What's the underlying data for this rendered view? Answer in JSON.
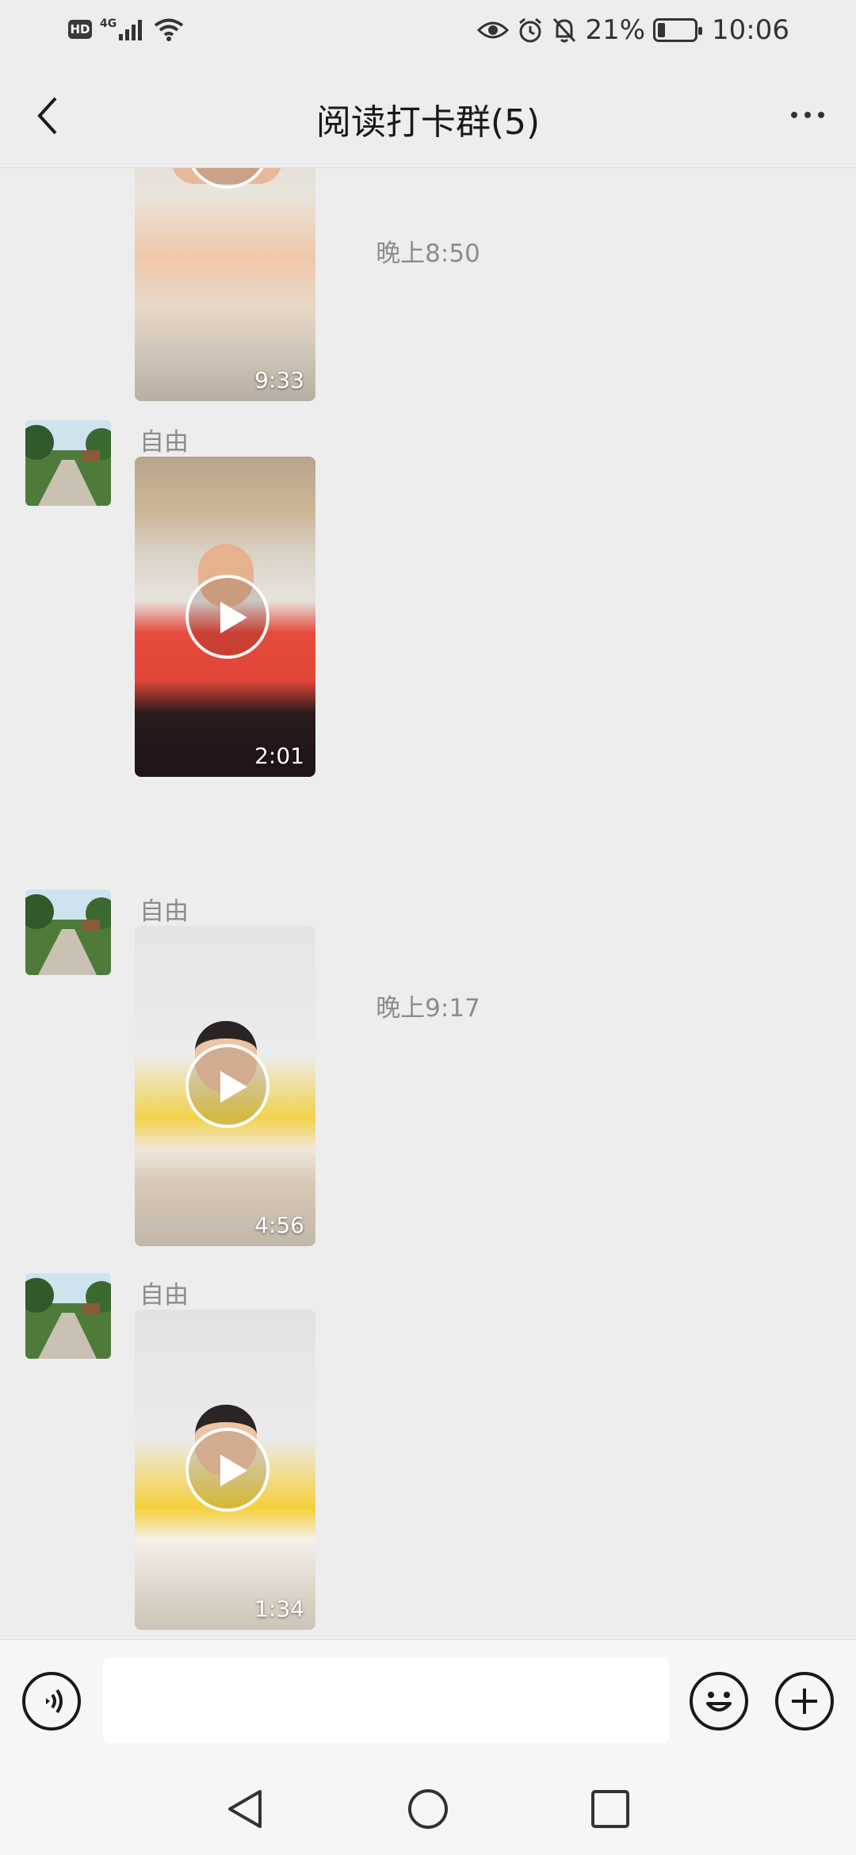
{
  "status_bar": {
    "hd": "HD",
    "network": "4G",
    "battery_percent": "21%",
    "battery_level": 0.21,
    "time": "10:06"
  },
  "header": {
    "back_icon": "chevron-left-icon",
    "title": "阅读打卡群(5)",
    "more_icon": "more-dots-icon"
  },
  "messages": [
    {
      "type": "video",
      "duration": "9:33",
      "partial": true
    },
    {
      "type": "time",
      "text": "晚上8:50"
    },
    {
      "type": "video",
      "sender": "自由",
      "duration": "2:01"
    },
    {
      "type": "time",
      "text": "晚上9:17"
    },
    {
      "type": "video",
      "sender": "自由",
      "duration": "4:56"
    },
    {
      "type": "video",
      "sender": "自由",
      "duration": "1:34"
    }
  ],
  "input_bar": {
    "voice_icon": "voice-icon",
    "text_value": "",
    "emoji_icon": "emoji-icon",
    "plus_icon": "plus-icon"
  },
  "system_nav": [
    "back-triangle-icon",
    "home-circle-icon",
    "recents-square-icon"
  ],
  "colors": {
    "background": "#ededed",
    "input_bar": "#f6f6f6",
    "timestamp_text": "#8c8c8c"
  }
}
